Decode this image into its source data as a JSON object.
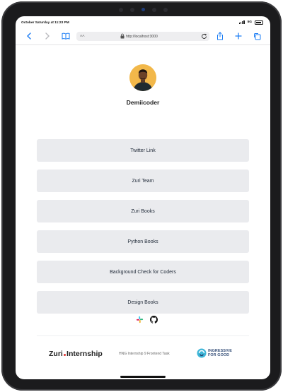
{
  "status_bar": {
    "time": "October Saturday at 11:23 PM",
    "network": "5G"
  },
  "browser": {
    "reader_label": "AA",
    "url": "http://localhost:3000"
  },
  "profile": {
    "username": "Demiicoder"
  },
  "links": [
    {
      "label": "Twitter Link"
    },
    {
      "label": "Zuri Team"
    },
    {
      "label": "Zuri Books"
    },
    {
      "label": "Python Books"
    },
    {
      "label": "Background Check for Coders"
    },
    {
      "label": "Design Books"
    }
  ],
  "socials": {
    "icons": [
      "slack-icon",
      "github-icon"
    ]
  },
  "footer": {
    "brand_left_word": "Zuri",
    "brand_right_word": "Internship",
    "note": "HNG Internship 9 Frontend Task",
    "partner_line1": "INGRESSIVE",
    "partner_line2": "FOR GOOD"
  },
  "colors": {
    "button_bg": "#eaebee",
    "avatar_bg": "#f2b84a",
    "accent_blue": "#1a7cf4",
    "zuri_dot": "#e0322f",
    "i4g_blue": "#38517a"
  }
}
